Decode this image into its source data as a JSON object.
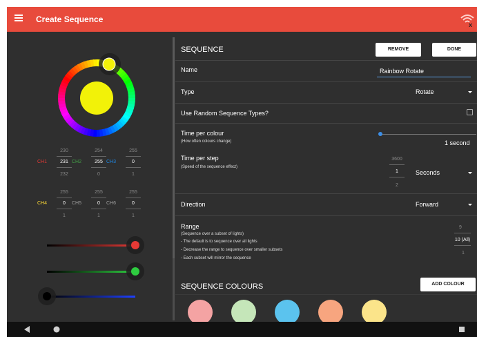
{
  "appbar": {
    "title": "Create Sequence",
    "menu_icon": "hamburger-menu-icon",
    "status_icon": "wifi-disconnected-icon",
    "color": "#e84b3c"
  },
  "picker": {
    "selected_color": "#f2f208",
    "channels": [
      {
        "label": "CH1",
        "above": "230",
        "value": "231",
        "below": "232",
        "color": "#e53935"
      },
      {
        "label": "CH2",
        "above": "254",
        "value": "255",
        "below": "0",
        "color": "#43a047"
      },
      {
        "label": "CH3",
        "above": "255",
        "value": "0",
        "below": "1",
        "color": "#1e88e5"
      },
      {
        "label": "CH4",
        "above": "255",
        "value": "0",
        "below": "1",
        "color": "#fdd835"
      },
      {
        "label": "CH5",
        "above": "255",
        "value": "0",
        "below": "1",
        "color": "#9e9e9e"
      },
      {
        "label": "CH6",
        "above": "255",
        "value": "0",
        "below": "1",
        "color": "#9e9e9e"
      }
    ],
    "sliders": [
      {
        "name": "red",
        "color": "#e53935",
        "level": 1.0
      },
      {
        "name": "green",
        "color": "#2ecc40",
        "level": 1.0
      },
      {
        "name": "blue",
        "color": "#1e40ff",
        "level": 0.0
      }
    ]
  },
  "sequence": {
    "header": "SEQUENCE",
    "remove_label": "REMOVE",
    "done_label": "DONE",
    "name_label": "Name",
    "name_value": "Rainbow Rotate",
    "type_label": "Type",
    "type_value": "Rotate",
    "random_label": "Use Random Sequence Types?",
    "random_checked": false,
    "time_per_colour_label": "Time per colour",
    "time_per_colour_sub": "(How often colours change)",
    "time_per_colour_value": "1 second",
    "time_per_colour_level": 0.0,
    "time_per_step_label": "Time per step",
    "time_per_step_sub": "(Speed of the sequence effect)",
    "step_above": "3600",
    "step_value": "1",
    "step_below": "2",
    "step_unit": "Seconds",
    "direction_label": "Direction",
    "direction_value": "Forward",
    "range_label": "Range",
    "range_sub": "(Sequence over a subset of lights)",
    "range_notes": [
      " - The default is to sequence over all lights",
      " - Decrease the range to sequence over smaller subsets",
      " - Each subset will mirror the sequence"
    ],
    "range_above": "9",
    "range_value": "10 (All)",
    "range_below": "1",
    "colours_header": "SEQUENCE COLOURS",
    "add_colour_label": "ADD COLOUR",
    "colours": [
      "#f4a3a3",
      "#c5e6b9",
      "#5bc3ee",
      "#f7a57f",
      "#fbe48a"
    ]
  },
  "navbar": {
    "back_icon": "back-triangle-icon",
    "home_icon": "home-circle-icon",
    "recents_icon": "recents-square-icon"
  }
}
